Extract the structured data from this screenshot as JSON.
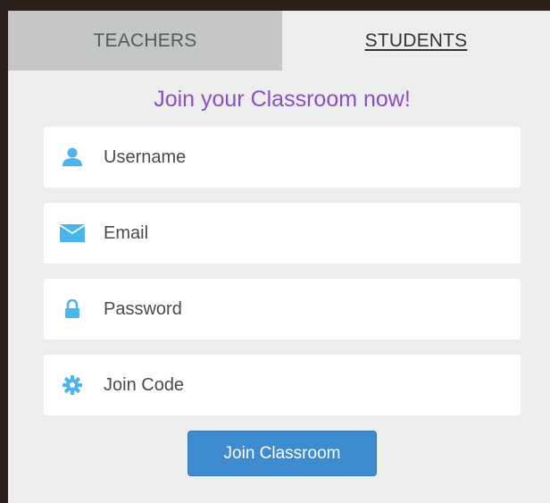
{
  "tabs": {
    "teachers": "TEACHERS",
    "students": "STUDENTS",
    "active": "students"
  },
  "form": {
    "headline": "Join your Classroom now!",
    "fields": [
      {
        "icon": "user-icon",
        "placeholder": "Username",
        "value": ""
      },
      {
        "icon": "envelope-icon",
        "placeholder": "Email",
        "value": ""
      },
      {
        "icon": "lock-icon",
        "placeholder": "Password",
        "value": ""
      },
      {
        "icon": "gear-icon",
        "placeholder": "Join Code",
        "value": ""
      }
    ],
    "submit_label": "Join Classroom"
  },
  "colors": {
    "headline": "#8b4fbf",
    "icon": "#4bb3ee",
    "button": "#3e8bd0",
    "inactive_tab": "#c4c7c6",
    "panel": "#eceeed"
  }
}
